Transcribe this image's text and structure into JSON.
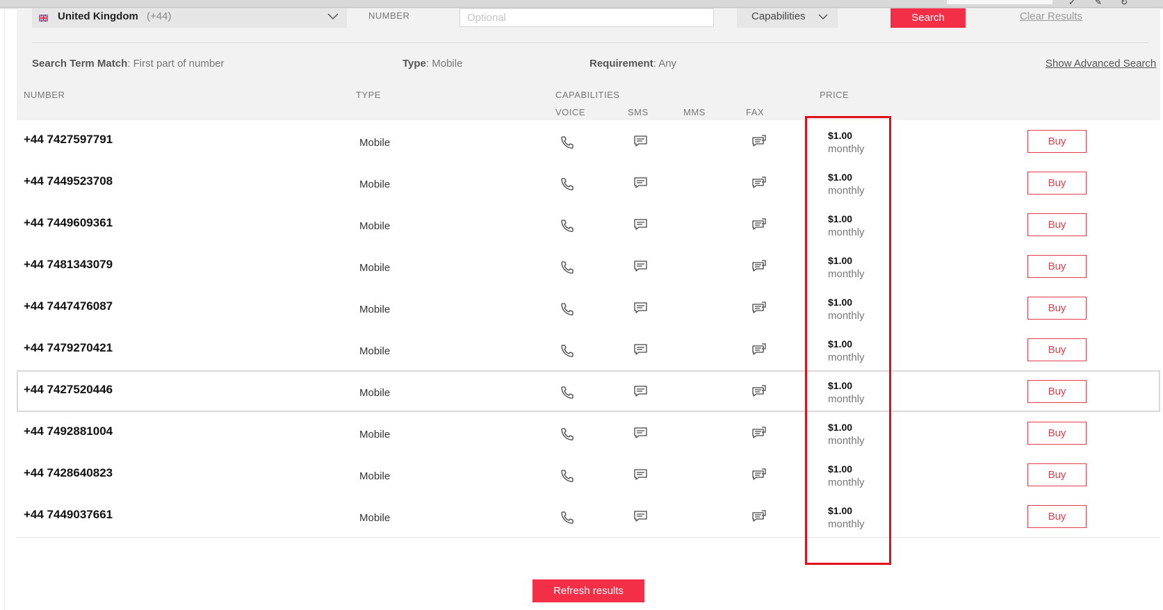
{
  "search": {
    "country_name": "United Kingdom",
    "country_code": "(+44)",
    "number_label": "NUMBER",
    "number_placeholder": "Optional",
    "number_value": "",
    "capabilities_label": "Capabilities",
    "search_label": "Search",
    "clear_label": "Clear Results"
  },
  "summary": {
    "match_label": "Search Term Match",
    "match_value": ": First part of number",
    "type_label": "Type",
    "type_value": ": Mobile",
    "requirement_label": "Requirement",
    "requirement_value": ": Any",
    "advanced_label": "Show Advanced Search"
  },
  "columns": {
    "number": "NUMBER",
    "type": "TYPE",
    "capabilities": "CAPABILITIES",
    "price": "PRICE",
    "voice": "VOICE",
    "sms": "SMS",
    "mms": "MMS",
    "fax": "FAX"
  },
  "rows": [
    {
      "number": "+44 7427597791",
      "type": "Mobile",
      "price": "$1.00",
      "period": "monthly",
      "buy": "Buy"
    },
    {
      "number": "+44 7449523708",
      "type": "Mobile",
      "price": "$1.00",
      "period": "monthly",
      "buy": "Buy"
    },
    {
      "number": "+44 7449609361",
      "type": "Mobile",
      "price": "$1.00",
      "period": "monthly",
      "buy": "Buy"
    },
    {
      "number": "+44 7481343079",
      "type": "Mobile",
      "price": "$1.00",
      "period": "monthly",
      "buy": "Buy"
    },
    {
      "number": "+44 7447476087",
      "type": "Mobile",
      "price": "$1.00",
      "period": "monthly",
      "buy": "Buy"
    },
    {
      "number": "+44 7479270421",
      "type": "Mobile",
      "price": "$1.00",
      "period": "monthly",
      "buy": "Buy"
    },
    {
      "number": "+44 7427520446",
      "type": "Mobile",
      "price": "$1.00",
      "period": "monthly",
      "buy": "Buy",
      "highlighted": true
    },
    {
      "number": "+44 7492881004",
      "type": "Mobile",
      "price": "$1.00",
      "period": "monthly",
      "buy": "Buy"
    },
    {
      "number": "+44 7428640823",
      "type": "Mobile",
      "price": "$1.00",
      "period": "monthly",
      "buy": "Buy"
    },
    {
      "number": "+44 7449037661",
      "type": "Mobile",
      "price": "$1.00",
      "period": "monthly",
      "buy": "Buy"
    }
  ],
  "refresh_label": "Refresh results",
  "colors": {
    "accent": "#f22f46",
    "buy_border": "#e23b4d",
    "annotation_red": "#e0101a",
    "panel_bg": "#f2f2f2"
  }
}
